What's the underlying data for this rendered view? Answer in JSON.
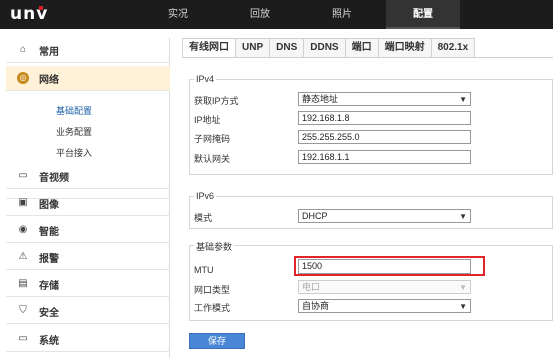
{
  "brand": {
    "logo_text": "unv"
  },
  "topnav": {
    "tabs": [
      {
        "label": "实况"
      },
      {
        "label": "回放"
      },
      {
        "label": "照片"
      },
      {
        "label": "配置",
        "active": true
      }
    ]
  },
  "sidebar": {
    "items": [
      {
        "label": "常用",
        "icon": "home-icon"
      },
      {
        "label": "网络",
        "icon": "network-icon",
        "active": true
      },
      {
        "label": "音视频",
        "icon": "video-icon"
      },
      {
        "label": "图像",
        "icon": "image-icon"
      },
      {
        "label": "智能",
        "icon": "smart-icon"
      },
      {
        "label": "报警",
        "icon": "alarm-icon"
      },
      {
        "label": "存储",
        "icon": "storage-icon"
      },
      {
        "label": "安全",
        "icon": "security-icon"
      },
      {
        "label": "系统",
        "icon": "system-icon"
      }
    ],
    "sub_items": [
      {
        "label": "基础配置",
        "active": true
      },
      {
        "label": "业务配置"
      },
      {
        "label": "平台接入"
      }
    ]
  },
  "tabs": [
    {
      "label": "有线网口",
      "active": true
    },
    {
      "label": "UNP"
    },
    {
      "label": "DNS"
    },
    {
      "label": "DDNS"
    },
    {
      "label": "端口"
    },
    {
      "label": "端口映射"
    },
    {
      "label": "802.1x"
    }
  ],
  "ipv4": {
    "title": "IPv4",
    "ip_mode_label": "获取IP方式",
    "ip_mode_value": "静态地址",
    "ip_label": "IP地址",
    "ip_value": "192.168.1.8",
    "mask_label": "子网掩码",
    "mask_value": "255.255.255.0",
    "gateway_label": "默认网关",
    "gateway_value": "192.168.1.1"
  },
  "ipv6": {
    "title": "IPv6",
    "mode_label": "模式",
    "mode_value": "DHCP"
  },
  "basic": {
    "title": "基础参数",
    "mtu_label": "MTU",
    "mtu_value": "1500",
    "port_type_label": "网口类型",
    "port_type_value": "电口",
    "work_mode_label": "工作模式",
    "work_mode_value": "自协商"
  },
  "actions": {
    "save_label": "保存"
  },
  "colors": {
    "highlight": "#e0262c",
    "save_button": "#4a86d6",
    "active_sidebar": "#fff2d8"
  }
}
